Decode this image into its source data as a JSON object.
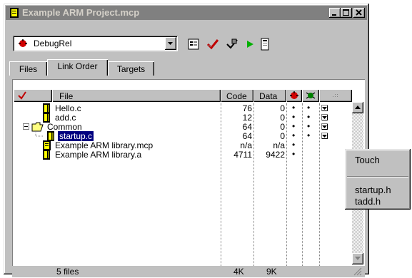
{
  "window": {
    "title": "Example ARM Project.mcp"
  },
  "toolbar": {
    "target_value": "DebugRel",
    "buttons": [
      "target-settings-icon",
      "check-syntax-icon",
      "make-icon",
      "run-icon",
      "synchronize-icon"
    ]
  },
  "tabs": [
    {
      "label": "Files",
      "active": false
    },
    {
      "label": "Link Order",
      "active": true
    },
    {
      "label": "Targets",
      "active": false
    }
  ],
  "columns": {
    "file": "File",
    "code": "Code",
    "data": "Data"
  },
  "files": [
    {
      "name": "Hello.c",
      "code": "76",
      "data": "0",
      "selected": false
    },
    {
      "name": "add.c",
      "code": "12",
      "data": "0",
      "selected": false
    },
    {
      "name": "Common",
      "code": "64",
      "data": "0",
      "selected": false
    },
    {
      "name": "startup.c",
      "code": "64",
      "data": "0",
      "selected": true
    },
    {
      "name": "Example ARM library.mcp",
      "code": "n/a",
      "data": "n/a",
      "selected": false
    },
    {
      "name": "Example ARM library.a",
      "code": "4711",
      "data": "9422",
      "selected": false
    }
  ],
  "status": {
    "count": "5 files",
    "code_total": "4K",
    "data_total": "9K"
  },
  "context_menu": {
    "items": [
      "Touch",
      "startup.h",
      "tadd.h"
    ]
  },
  "colors": {
    "title_inactive": "#808080",
    "selection": "#000080",
    "chrome": "#c0c0c0"
  }
}
